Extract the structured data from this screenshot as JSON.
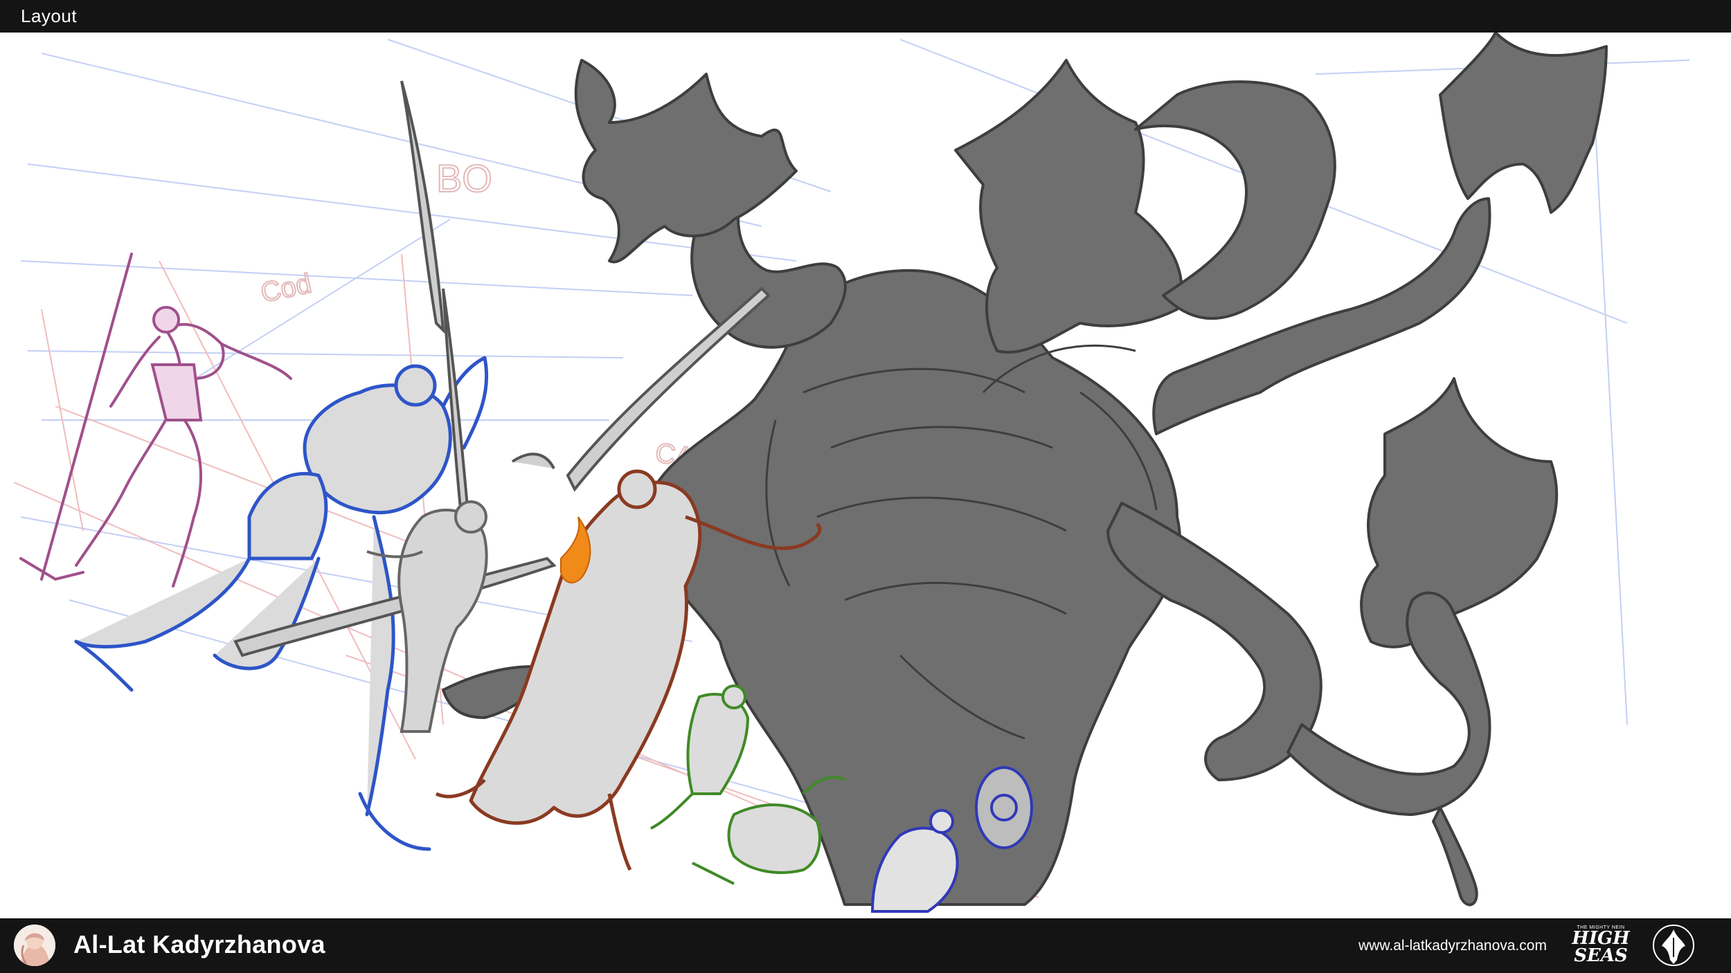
{
  "window": {
    "title": "Layout"
  },
  "canvas": {
    "sketch_labels": [
      "BO",
      "Cod",
      "CALEB"
    ]
  },
  "footer": {
    "author_name": "Al-Lat Kadyrzhanova",
    "website": "www.al-latkadyrzhanova.com",
    "logo_small_text": "THE MIGHTY NEIN",
    "logo_text_line1": "HIGH",
    "logo_text_line2": "SEAS",
    "avatar_icon": "author-avatar-icon",
    "emblem_icon": "emblem-icon"
  },
  "colors": {
    "bar_background": "#141414",
    "monster_gray": "#6f6f6f",
    "figure_purple": "#a0508c",
    "figure_blue": "#2e55c8",
    "figure_brown": "#8a3a22",
    "figure_green": "#3f8a26",
    "figure_navy": "#3038b8",
    "flame_orange": "#f08a18",
    "guide_blue": "#b9c6f2",
    "guide_red": "#efb8b8"
  }
}
